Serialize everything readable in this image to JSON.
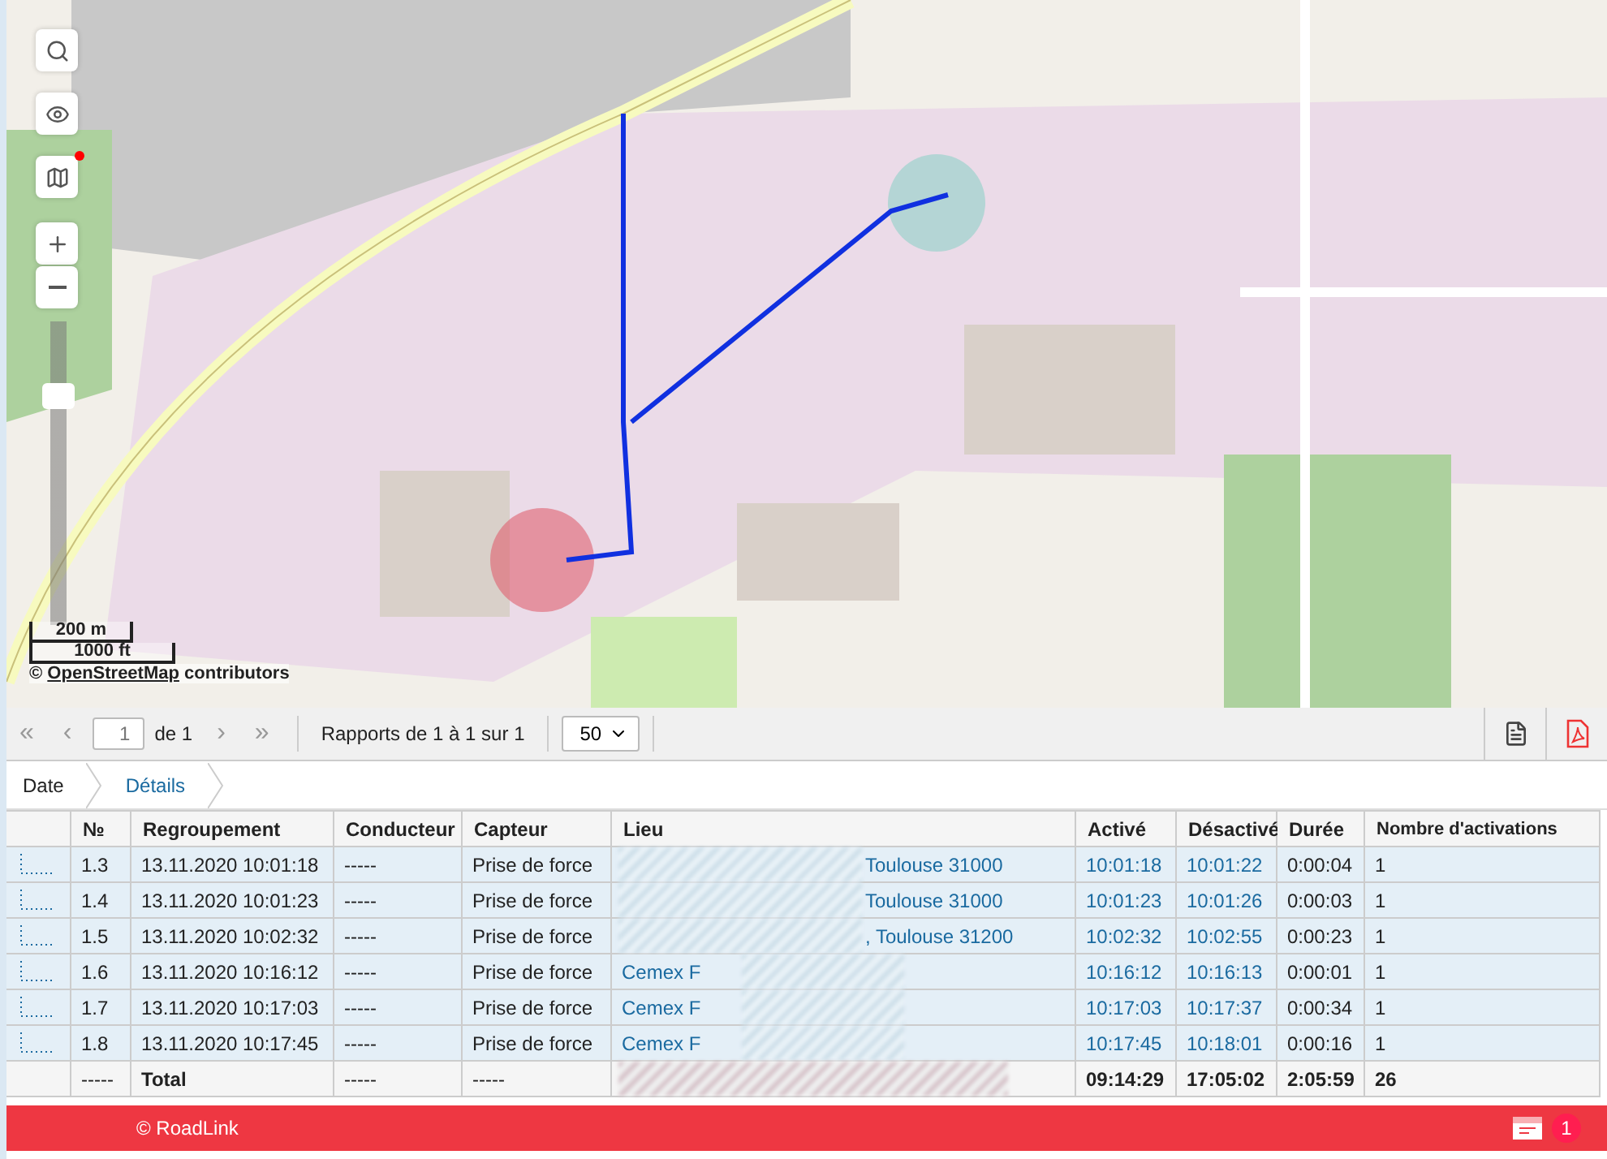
{
  "map": {
    "zoom": {
      "level": 0.78
    },
    "scale": {
      "metric": "200 m",
      "imperial": "1000 ft"
    },
    "attribution": {
      "prefix": "©",
      "link": "OpenStreetMap",
      "suffix": "contributors"
    },
    "layers_alert": true
  },
  "pager": {
    "first": "«",
    "prev": "‹",
    "page": "1",
    "of": "de 1",
    "next": "›",
    "last": "»",
    "summary": "Rapports de 1 à 1 sur 1",
    "page_size": "50"
  },
  "breadcrumb": [
    {
      "label": "Date",
      "selected": false
    },
    {
      "label": "Détails",
      "selected": true
    }
  ],
  "table": {
    "columns": [
      "№",
      "Regroupement",
      "Conducteur",
      "Capteur",
      "Lieu",
      "Activé",
      "Désactivé",
      "Durée",
      "Nombre d'activations"
    ],
    "rows": [
      {
        "no": "1.3",
        "group": "13.11.2020 10:01:18",
        "driver": "-----",
        "sensor": "Prise de force",
        "place": "Toulouse 31000",
        "kind": "masked_start",
        "on": "10:01:18",
        "off": "10:01:22",
        "duration": "0:00:04",
        "count": "1"
      },
      {
        "no": "1.4",
        "group": "13.11.2020 10:01:23",
        "driver": "-----",
        "sensor": "Prise de force",
        "place": "Toulouse 31000",
        "kind": "masked_start",
        "on": "10:01:23",
        "off": "10:01:26",
        "duration": "0:00:03",
        "count": "1"
      },
      {
        "no": "1.5",
        "group": "13.11.2020 10:02:32",
        "driver": "-----",
        "sensor": "Prise de force",
        "place": ", Toulouse 31200",
        "kind": "masked_start",
        "on": "10:02:32",
        "off": "10:02:55",
        "duration": "0:00:23",
        "count": "1"
      },
      {
        "no": "1.6",
        "group": "13.11.2020 10:16:12",
        "driver": "-----",
        "sensor": "Prise de force",
        "place": "Cemex F",
        "kind": "masked_end",
        "on": "10:16:12",
        "off": "10:16:13",
        "duration": "0:00:01",
        "count": "1"
      },
      {
        "no": "1.7",
        "group": "13.11.2020 10:17:03",
        "driver": "-----",
        "sensor": "Prise de force",
        "place": "Cemex F",
        "kind": "masked_end",
        "on": "10:17:03",
        "off": "10:17:37",
        "duration": "0:00:34",
        "count": "1"
      },
      {
        "no": "1.8",
        "group": "13.11.2020 10:17:45",
        "driver": "-----",
        "sensor": "Prise de force",
        "place": "Cemex F",
        "kind": "masked_end",
        "on": "10:17:45",
        "off": "10:18:01",
        "duration": "0:00:16",
        "count": "1"
      }
    ],
    "total": {
      "no": "-----",
      "group": "Total",
      "driver": "-----",
      "sensor": "-----",
      "on": "09:14:29",
      "off": "17:05:02",
      "duration": "2:05:59",
      "count": "26"
    }
  },
  "footer": {
    "copyright": "© RoadLink",
    "notifications": "1"
  }
}
